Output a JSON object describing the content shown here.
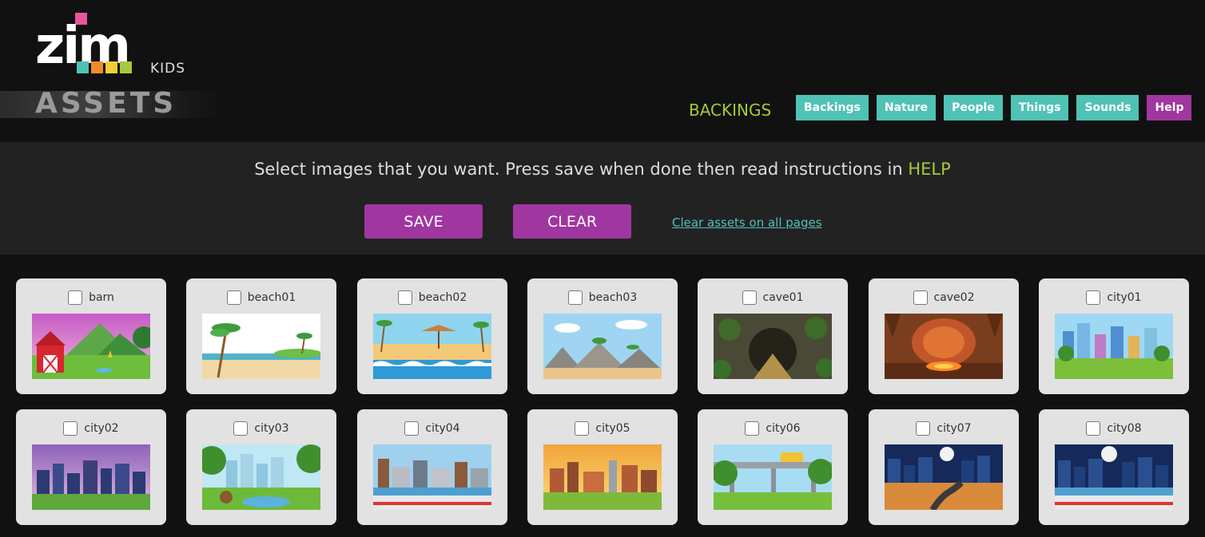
{
  "logo": {
    "brand": "zim",
    "sub": "KIDS",
    "title": "ASSETS",
    "square_colors": [
      "#50c2b5",
      "#f08a2a",
      "#f2cf34",
      "#a6c93b"
    ]
  },
  "header": {
    "page_title": "BACKINGS",
    "nav": [
      {
        "label": "Backings",
        "color": "#50c2b5"
      },
      {
        "label": "Nature",
        "color": "#50c2b5"
      },
      {
        "label": "People",
        "color": "#50c2b5"
      },
      {
        "label": "Things",
        "color": "#50c2b5"
      },
      {
        "label": "Sounds",
        "color": "#50c2b5"
      },
      {
        "label": "Help",
        "color": "#a0369f"
      }
    ]
  },
  "controls": {
    "instruction_text": "Select images that you want. Press save when done then read instructions in ",
    "instruction_highlight": "HELP",
    "save_label": "SAVE",
    "clear_label": "CLEAR",
    "clear_all_link": "Clear assets on all pages"
  },
  "assets": [
    {
      "label": "barn",
      "checked": false
    },
    {
      "label": "beach01",
      "checked": false
    },
    {
      "label": "beach02",
      "checked": false
    },
    {
      "label": "beach03",
      "checked": false
    },
    {
      "label": "cave01",
      "checked": false
    },
    {
      "label": "cave02",
      "checked": false
    },
    {
      "label": "city01",
      "checked": false
    },
    {
      "label": "city02",
      "checked": false
    },
    {
      "label": "city03",
      "checked": false
    },
    {
      "label": "city04",
      "checked": false
    },
    {
      "label": "city05",
      "checked": false
    },
    {
      "label": "city06",
      "checked": false
    },
    {
      "label": "city07",
      "checked": false
    },
    {
      "label": "city08",
      "checked": false
    }
  ],
  "colors": {
    "accent_purple": "#a0369f",
    "accent_teal": "#50c2b5",
    "accent_green": "#a6c93b"
  }
}
